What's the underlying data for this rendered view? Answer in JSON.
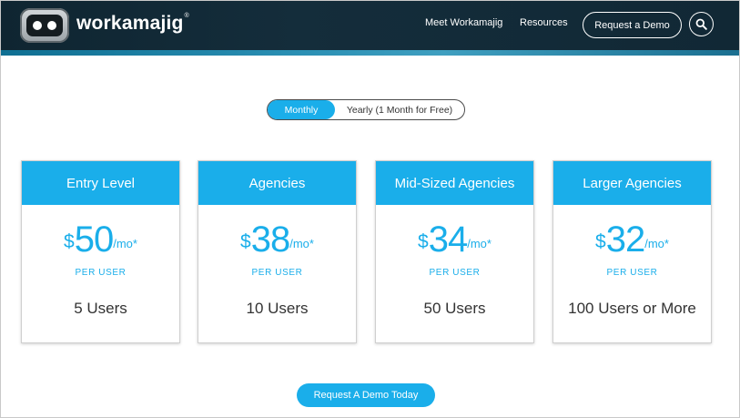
{
  "header": {
    "brand": "workamajig",
    "brand_mark": "®",
    "nav": {
      "meet": "Meet Workamajig",
      "resources": "Resources",
      "request_demo": "Request a Demo"
    },
    "search_icon": "search-icon"
  },
  "billing": {
    "monthly": "Monthly",
    "yearly": "Yearly (1 Month for Free)",
    "selected": "Monthly"
  },
  "plans": [
    {
      "name": "Entry Level",
      "currency": "$",
      "price": "50",
      "period": "/mo*",
      "per_user": "PER USER",
      "users": "5 Users"
    },
    {
      "name": "Agencies",
      "currency": "$",
      "price": "38",
      "period": "/mo*",
      "per_user": "PER USER",
      "users": "10 Users"
    },
    {
      "name": "Mid-Sized Agencies",
      "currency": "$",
      "price": "34",
      "period": "/mo*",
      "per_user": "PER USER",
      "users": "50 Users"
    },
    {
      "name": "Larger Agencies",
      "currency": "$",
      "price": "32",
      "period": "/mo*",
      "per_user": "PER USER",
      "users": "100 Users or More"
    }
  ],
  "cta": "Request A Demo Today",
  "colors": {
    "accent": "#1aaeea",
    "header_bg": "#112835",
    "header_strip": "#2a8fb3",
    "text_dark": "#333333"
  }
}
